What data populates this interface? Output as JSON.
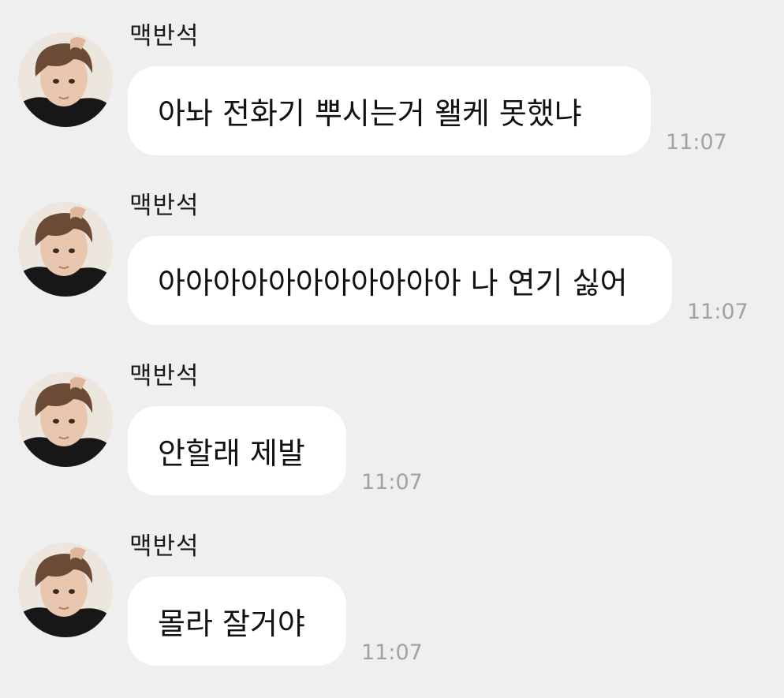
{
  "colors": {
    "background": "#efefef",
    "bubble": "#ffffff",
    "text": "#111111",
    "timestamp": "#a2a2a2"
  },
  "messages": [
    {
      "sender": "맥반석",
      "avatar_icon": "profile-photo",
      "text": "아놔 전화기 뿌시는거 왤케 못했냐",
      "time": "11:07"
    },
    {
      "sender": "맥반석",
      "avatar_icon": "profile-photo",
      "text": "아아아아아아아아아아아 나 연기 싫어",
      "time": "11:07"
    },
    {
      "sender": "맥반석",
      "avatar_icon": "profile-photo",
      "text": "안할래 제발",
      "time": "11:07"
    },
    {
      "sender": "맥반석",
      "avatar_icon": "profile-photo",
      "text": "몰라 잘거야",
      "time": "11:07"
    }
  ]
}
